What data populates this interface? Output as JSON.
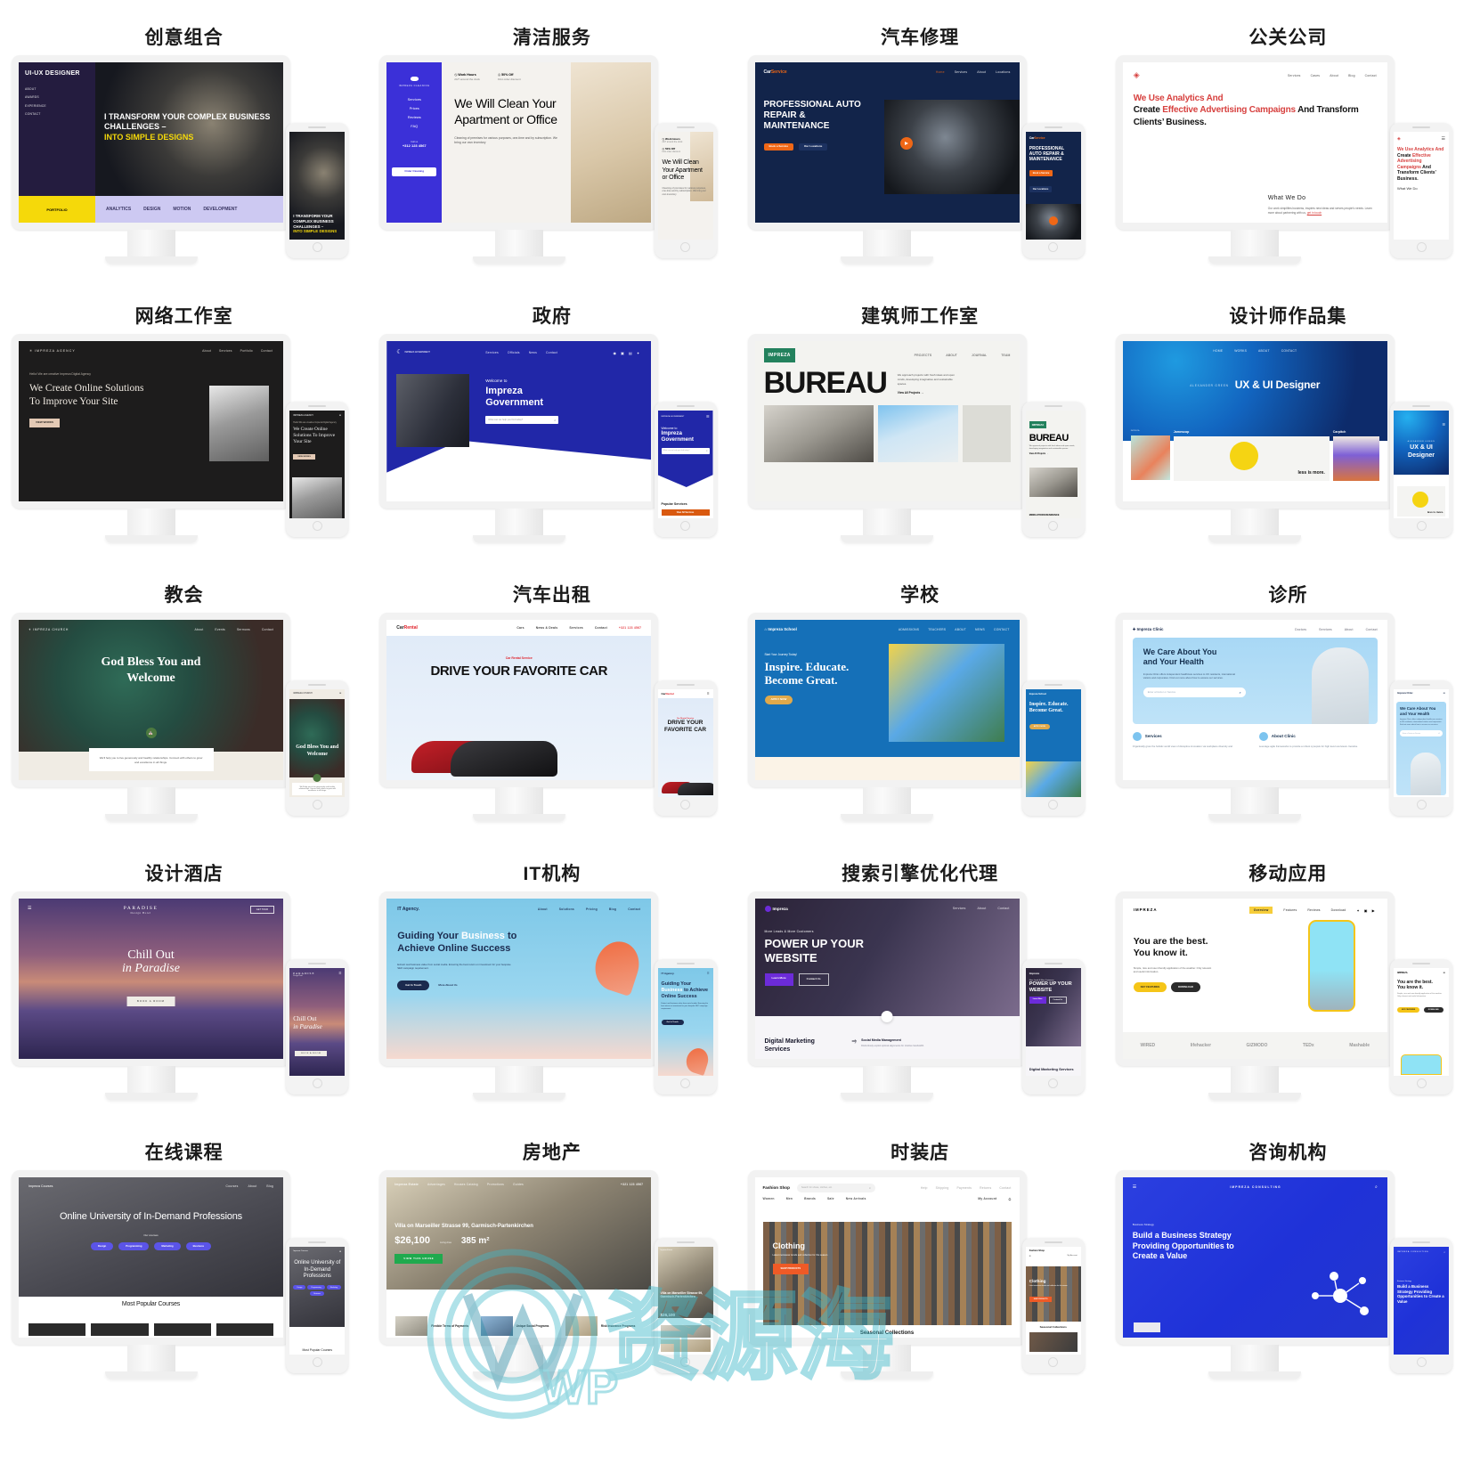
{
  "page": {
    "columns": 4,
    "rows": 5,
    "watermark": "WP资源海",
    "background": "#ffffff"
  },
  "cells": [
    {
      "title": "创意组合",
      "site_name": "UI-UX DESIGNER",
      "nav": [
        "ABOUT",
        "AWARDS",
        "EXPERIENCE",
        "CONTACT"
      ],
      "headline": "I TRANSFORM YOUR COMPLEX BUSINESS CHALLENGES –",
      "headline_accent": "INTO SIMPLE DESIGNS",
      "tag": "PORTFOLIO",
      "tabs": [
        "ANALYTICS",
        "DESIGN",
        "MOTION",
        "DEVELOPMENT"
      ],
      "accent": "#f5d90a",
      "dark": "#241c3f"
    },
    {
      "title": "清洁服务",
      "site_name": "IMPREZA CLEANING",
      "nav": [
        "Services",
        "Prices",
        "Reviews",
        "FAQ"
      ],
      "badge1_title": "Work Hours",
      "badge1_sub": "24/7 around the clock",
      "badge2_title": "50% Off",
      "badge2_sub": "First order discount",
      "headline": "We Will Clean Your Apartment or Office",
      "body": "Cleaning of premises for various purposes, one-time and by subscription. We bring our own inventory",
      "phone_label": "Call us",
      "phone_number": "+312 123 4567",
      "button": "Order Cleaning",
      "accent": "#3b30d8"
    },
    {
      "title": "汽车修理",
      "site_name": "CarService",
      "nav": [
        "Home",
        "Services",
        "About",
        "Locations"
      ],
      "headline": "PROFESSIONAL AUTO REPAIR & MAINTENANCE",
      "button1": "Book a Service",
      "button2": "Our Locations",
      "accent": "#ef6716",
      "dark": "#12244a"
    },
    {
      "title": "公关公司",
      "nav": [
        "Services",
        "Cases",
        "About",
        "Blog",
        "Contact"
      ],
      "headline_parts": [
        {
          "text": "We Use Analytics And ",
          "color": "red"
        },
        {
          "text": "Create ",
          "color": "black"
        },
        {
          "text": "Effective Advertising Campaigns ",
          "color": "red"
        },
        {
          "text": "And Transform Clients’ Business.",
          "color": "black"
        }
      ],
      "sub_title": "What We Do",
      "body": "Our work simplifies business, inspires new ideas and serves people's needs. Learn more about partnering with us,",
      "link": "get in touch",
      "accent": "#d7413f"
    },
    {
      "title": "网络工作室",
      "site_name": "IMPREZA AGENCY",
      "nav": [
        "About",
        "Services",
        "Portfolio",
        "Contact"
      ],
      "eyebrow": "Hello! We are creative Impreza Digital Agency",
      "headline": "We Create Online Solutions To Improve Your Site",
      "button": "VIEW WORKS",
      "accent": "#e3c9b4",
      "dark": "#1d1c1c"
    },
    {
      "title": "政府",
      "site_name": "IMPREZA GOVERNMENT",
      "nav": [
        "Services",
        "Officials",
        "News",
        "Contact"
      ],
      "eyebrow": "Welcome to",
      "headline": "Impreza Government",
      "search_placeholder": "What can we help you find today?",
      "section": "Popular Services",
      "button": "View All Services",
      "accent": "#2127a8",
      "cta": "#d9590f"
    },
    {
      "title": "建筑师工作室",
      "site_name": "IMPREZA",
      "nav": [
        "PROJECTS",
        "ABOUT",
        "JOURNAL",
        "TEAM"
      ],
      "headline": "BUREAU",
      "body": "We approach projects with fresh ideas and open minds, developing imaginative and sustainable spaces.",
      "link": "View All Projects →",
      "caption": "MIDDLETOWN RESIDENCE",
      "accent": "#23815d"
    },
    {
      "title": "设计师作品集",
      "nav": [
        "HOME",
        "WORKS",
        "ABOUT",
        "CONTACT"
      ],
      "eyebrow": "ALEXANDER GREEN",
      "headline": "UX & UI Designer",
      "work1": "Jamescop",
      "work2": "Carpitch",
      "work_caption": "less is more.",
      "accent": "#1a6fd4"
    },
    {
      "title": "教会",
      "site_name": "IMPREZA CHURCH",
      "nav": [
        "About",
        "Events",
        "Sermons",
        "Contact"
      ],
      "headline": "God Bless You and Welcome",
      "body": "We'll help you to live generously and healthy relationships. Connect with others to grow and excellence in all things.",
      "accent": "#4c7a3f"
    },
    {
      "title": "汽车出租",
      "site_name": "Car Rental",
      "nav": [
        "Cars",
        "News & Deals",
        "Services",
        "Contact"
      ],
      "phone_number": "+321 123 4567",
      "eyebrow": "Car Rental Service",
      "headline": "DRIVE YOUR FAVORITE CAR",
      "accent": "#e0222b"
    },
    {
      "title": "学校",
      "site_name": "Impreza School",
      "nav": [
        "ADMISSIONS",
        "TEACHERS",
        "ABOUT",
        "NEWS",
        "CONTACT"
      ],
      "eyebrow": "Start Your Journey Today!",
      "headline": "Inspire. Educate. Become Great.",
      "button": "APPLY NOW",
      "accent": "#1570b8",
      "cta": "#e0a94b"
    },
    {
      "title": "诊所",
      "site_name": "Impreza Clinic",
      "nav": [
        "Doctors",
        "Services",
        "About",
        "Contact"
      ],
      "headline": "We Care About You and Your Health",
      "body": "Impreza Clinic offers independent healthcare services to UK residents, international visitors and corporates. Find out more about how to access our services.",
      "search_placeholder": "Enter a Doctor or Service",
      "card1": "Services",
      "card1_body": "Organically grow the holistic world view of disruptive innovation via workplace diversity and",
      "card2": "About Clinic",
      "card2_body": "Leverage agile frameworks to provide a robust synopsis for high level overviews. Iterative",
      "accent": "#a9daf5"
    },
    {
      "title": "设计酒店",
      "site_name": "PARADISE",
      "site_sub": "Design Hotel",
      "button_top": "GET TOUR",
      "headline_1": "Chill Out",
      "headline_2": "in Paradise",
      "button": "BOOK A ROOM",
      "accent": "#5f4f93"
    },
    {
      "title": "IT机构",
      "site_name": "IT Agency.",
      "nav": [
        "About",
        "Solutions",
        "Pricing",
        "Blog",
        "Contact"
      ],
      "headline_1": "Guiding Your",
      "headline_2": "Business",
      "headline_3": "to Achieve Online Success",
      "body": "Extract real business value from social media. Ensuring the best return on investment for your bespoke SEO campaign requirement.",
      "button1": "Get In Touch",
      "button2": "More About Us",
      "accent": "#6fc3e3",
      "dark": "#1b2a4e"
    },
    {
      "title": "搜索引擎优化代理",
      "site_name": "Impreza",
      "nav": [
        "Services",
        "About",
        "Contact"
      ],
      "eyebrow": "More Leads & More Customers",
      "headline": "POWER UP YOUR WEBSITE",
      "button1": "Learn More",
      "button2": "Contact Us",
      "section": "Digital Marketing Services",
      "card_title": "Social Media Management",
      "card_body": "Distinctively exploit optimal alignments for intuitive bandwidth.",
      "accent": "#6c2bd9"
    },
    {
      "title": "移动应用",
      "site_name": "IMPREZA",
      "nav": [
        "Overview",
        "Features",
        "Reviews",
        "Download"
      ],
      "headline_1": "You are the best.",
      "headline_2": "You know it.",
      "body": "Simple, nice and user-friendly application of the weather. Only relevant and useful information.",
      "button1": "KEY FEATURES",
      "button2": "DOWNLOAD",
      "logos": [
        "WIRED",
        "lifehacker",
        "GIZMODO",
        "TEDx",
        "Mashable"
      ],
      "accent": "#f5c518"
    },
    {
      "title": "在线课程",
      "site_name": "Impreza Courses",
      "nav": [
        "Courses",
        "About",
        "Blog"
      ],
      "headline": "Online University of In-Demand Professions",
      "eyebrow": "Our courses",
      "chips": [
        "Design",
        "Programming",
        "Marketing",
        "Business"
      ],
      "section": "Most Popular Courses",
      "accent": "#5b54e8"
    },
    {
      "title": "房地产",
      "site_name": "Impreza Estate",
      "nav": [
        "Advantages",
        "Houses Catalog",
        "Promotions",
        "Guides"
      ],
      "phone_number": "+321 123 4567",
      "headline": "Villa on Marseiller Strasse 99, Garmisch-Partenkirchen",
      "price": "$26,100",
      "area_label": "Living Area",
      "area": "385 m²",
      "button": "VIEW THIS HOUSE",
      "feature1": "Flexible Terms of Payments",
      "feature2": "Unique Social Programs",
      "feature3": "Risk Insurance Programs",
      "accent": "#1faa4e"
    },
    {
      "title": "时装店",
      "site_name": "Fashion Shop",
      "search_placeholder": "Search for shoes, clothes, etc.",
      "nav_top": [
        "Help",
        "Shipping",
        "Payments",
        "Returns",
        "Contact"
      ],
      "nav_cats": [
        "Women",
        "Men",
        "Brands",
        "Sale",
        "New Arrivals"
      ],
      "account": "My Account",
      "headline": "Clothing",
      "body": "Latest menswear trends and collection for this season",
      "button": "SHOP PRODUCTS",
      "section": "Seasonal Collections",
      "accent": "#ef5a26"
    },
    {
      "title": "咨询机构",
      "site_name": "IMPREZA CONSULTING",
      "eyebrow": "Business Strategy",
      "headline": "Build a Business Strategy Providing Opportunities to Create a Value",
      "accent": "#2339e0"
    }
  ]
}
